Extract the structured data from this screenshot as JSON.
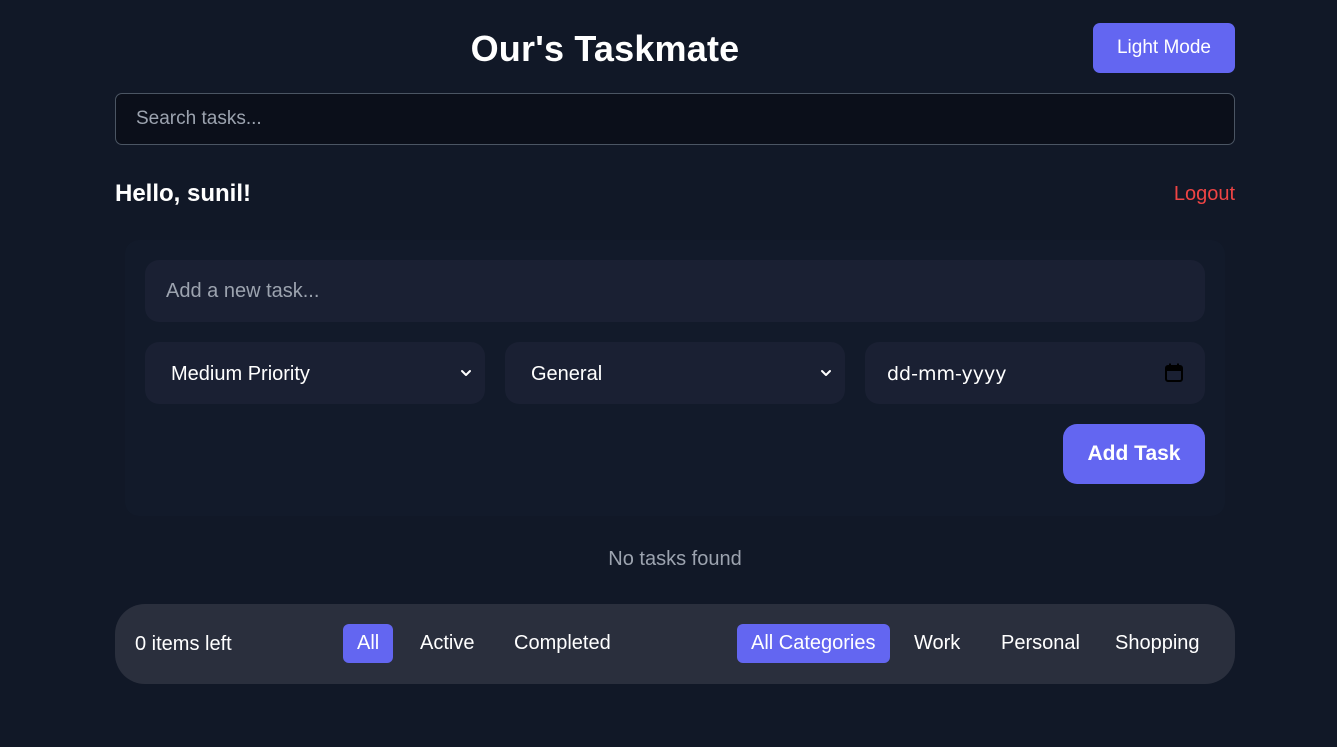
{
  "header": {
    "title": "Our's Taskmate",
    "theme_toggle_label": "Light Mode"
  },
  "search": {
    "placeholder": "Search tasks..."
  },
  "user": {
    "greeting": "Hello, sunil!",
    "logout_label": "Logout"
  },
  "task_form": {
    "new_task_placeholder": "Add a new task...",
    "priority_selected": "Medium Priority",
    "category_selected": "General",
    "date_placeholder": "dd-mm-yyyy",
    "add_button_label": "Add Task"
  },
  "tasks": {
    "empty_message": "No tasks found"
  },
  "footer": {
    "items_left": "0 items left",
    "status_filters": [
      {
        "label": "All",
        "active": true
      },
      {
        "label": "Active",
        "active": false
      },
      {
        "label": "Completed",
        "active": false
      }
    ],
    "category_filters": [
      {
        "label": "All Categories",
        "active": true
      },
      {
        "label": "Work",
        "active": false
      },
      {
        "label": "Personal",
        "active": false
      },
      {
        "label": "Shopping",
        "active": false
      }
    ]
  },
  "colors": {
    "background": "#111827",
    "accent": "#6366f1",
    "danger": "#ef4444",
    "muted_text": "#9ca3af"
  },
  "icons": {
    "select_arrow": "chevron-down-icon",
    "date_picker": "calendar-icon"
  }
}
